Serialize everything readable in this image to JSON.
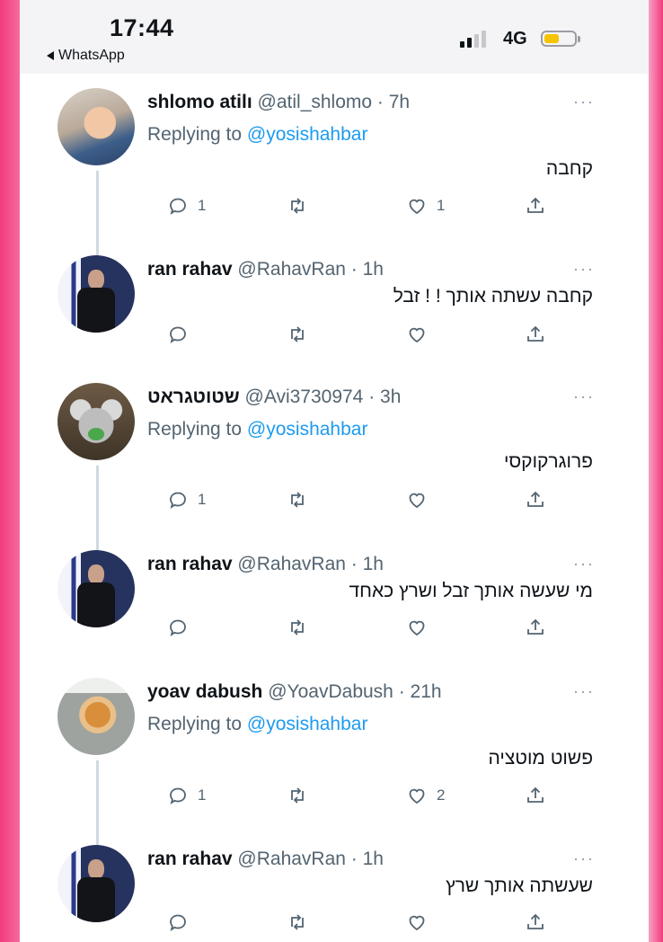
{
  "status_bar": {
    "time": "17:44",
    "back_app": "WhatsApp",
    "network": "4G",
    "battery_color": "#f5c400"
  },
  "tweets": [
    {
      "name": "shlomo atilı",
      "handle": "@atil_shlomo",
      "time": "7h",
      "replying_prefix": "Replying to ",
      "replying_to": "@yosishahbar",
      "text": "קחבה",
      "replies": "1",
      "retweets": "",
      "likes": "1",
      "avatar": "baby-photo"
    },
    {
      "name": "ran rahav",
      "handle": "@RahavRan",
      "time": "1h",
      "text": "קחבה עשתה אותך ! ! זבל",
      "replies": "",
      "retweets": "",
      "likes": "",
      "avatar": "man-with-flag-photo"
    },
    {
      "name": "שטוטגראט",
      "handle": "@Avi3730974",
      "time": "3h",
      "replying_prefix": "Replying to ",
      "replying_to": "@yosishahbar",
      "text": "פרוגרקוקסי",
      "replies": "1",
      "retweets": "",
      "likes": "",
      "avatar": "koala-photo"
    },
    {
      "name": "ran rahav",
      "handle": "@RahavRan",
      "time": "1h",
      "text": "מי שעשה אותך זבל ושרץ כאחד",
      "replies": "",
      "retweets": "",
      "likes": "",
      "avatar": "man-with-flag-photo"
    },
    {
      "name": "yoav dabush",
      "handle": "@YoavDabush",
      "time": "21h",
      "replying_prefix": "Replying to ",
      "replying_to": "@yosishahbar",
      "text": "פשוט מוטציה",
      "replies": "1",
      "retweets": "",
      "likes": "2",
      "avatar": "food-jar-photo"
    },
    {
      "name": "ran rahav",
      "handle": "@RahavRan",
      "time": "1h",
      "text": "שעשתה אותך שרץ",
      "replies": "",
      "retweets": "",
      "likes": "",
      "avatar": "man-with-flag-photo"
    }
  ],
  "more_glyph": "···",
  "separator": " · ",
  "colors": {
    "link_blue": "#1d9bf0",
    "muted": "#536471",
    "thread_line": "#cfd9de",
    "frame_pink": "#f23b7e"
  }
}
